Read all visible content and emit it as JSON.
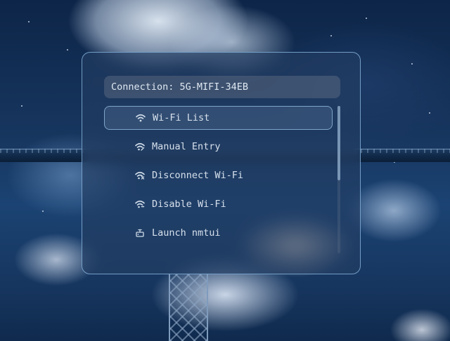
{
  "connection": {
    "label": "Connection: 5G-MIFI-34EB"
  },
  "menu": {
    "items": [
      {
        "label": "Wi-Fi List",
        "icon": "wifi-icon",
        "selected": true
      },
      {
        "label": "Manual Entry",
        "icon": "wifi-edit-icon",
        "selected": false
      },
      {
        "label": "Disconnect Wi-Fi",
        "icon": "wifi-disconnect-icon",
        "selected": false
      },
      {
        "label": "Disable Wi-Fi",
        "icon": "wifi-off-icon",
        "selected": false
      },
      {
        "label": "Launch nmtui",
        "icon": "terminal-icon",
        "selected": false
      }
    ]
  },
  "colors": {
    "panel_border": "#82afd7",
    "text": "#d6e0ec",
    "accent": "#8cb4d7"
  }
}
